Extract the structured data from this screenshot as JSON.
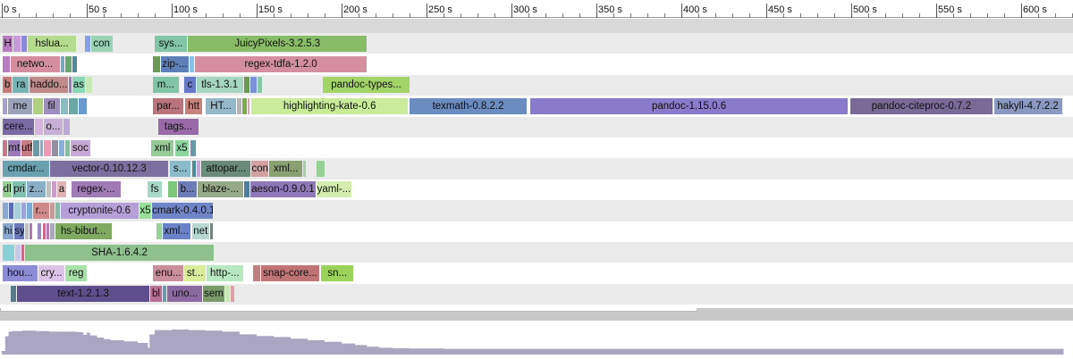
{
  "ruler": {
    "ticks": [
      "0 s",
      "50 s",
      "100 s",
      "150 s",
      "200 s",
      "250 s",
      "300 s",
      "350 s",
      "400 s",
      "450 s",
      "500 s",
      "550 s",
      "600 s"
    ]
  },
  "lanes": [
    [
      {
        "label": "H",
        "start": 0.5,
        "end": 6.5,
        "color": "#b87cc0"
      },
      {
        "label": "",
        "start": 7,
        "end": 11,
        "color": "#c59ad8"
      },
      {
        "label": "",
        "start": 11.5,
        "end": 15,
        "color": "#8a8ad6"
      },
      {
        "label": "hslua...",
        "start": 15.5,
        "end": 43.5,
        "color": "#b4dc8c"
      },
      {
        "label": "",
        "start": 49,
        "end": 52,
        "color": "#86a0e4"
      },
      {
        "label": "con",
        "start": 52.5,
        "end": 65,
        "color": "#9ad2b4"
      },
      {
        "label": "sys...",
        "start": 90,
        "end": 109,
        "color": "#80c5a6"
      },
      {
        "label": "JuicyPixels-3.2.5.3",
        "start": 109.5,
        "end": 215,
        "color": "#88bc66"
      }
    ],
    [
      {
        "label": "",
        "start": 0.5,
        "end": 4.5,
        "color": "#b87cc0"
      },
      {
        "label": "netwo...",
        "start": 5,
        "end": 34,
        "color": "#d48e9e"
      },
      {
        "label": "",
        "start": 34.5,
        "end": 37,
        "color": "#7aa8b8"
      },
      {
        "label": "",
        "start": 37.5,
        "end": 41,
        "color": "#68a870"
      },
      {
        "label": "",
        "start": 41.5,
        "end": 44,
        "color": "#4e8a9a"
      },
      {
        "label": "",
        "start": 89,
        "end": 93,
        "color": "#6a9a56"
      },
      {
        "label": "zip-...",
        "start": 93.5,
        "end": 110,
        "color": "#5d80b8"
      },
      {
        "label": "",
        "start": 110.5,
        "end": 113,
        "color": "#8ac0e8"
      },
      {
        "label": "regex-tdfa-1.2.0",
        "start": 113.5,
        "end": 215,
        "color": "#d48e9e"
      }
    ],
    [
      {
        "label": "b",
        "start": 0.5,
        "end": 6,
        "color": "#c77a7a"
      },
      {
        "label": "ra",
        "start": 6.5,
        "end": 16,
        "color": "#78b4b4"
      },
      {
        "label": "haddo...",
        "start": 16.5,
        "end": 39,
        "color": "#c08a8a"
      },
      {
        "label": "",
        "start": 39.5,
        "end": 41,
        "color": "#9a7ab8"
      },
      {
        "label": "as",
        "start": 41.5,
        "end": 49,
        "color": "#8ad6b6"
      },
      {
        "label": "",
        "start": 49.5,
        "end": 53,
        "color": "#c8e8b8"
      },
      {
        "label": "m...",
        "start": 89,
        "end": 104,
        "color": "#80c5a6"
      },
      {
        "label": "",
        "start": 104.5,
        "end": 107,
        "color": "#f4f4f4"
      },
      {
        "label": "c",
        "start": 107.5,
        "end": 114,
        "color": "#6678c8"
      },
      {
        "label": "tls-1.3.1",
        "start": 114.5,
        "end": 142,
        "color": "#a6d6c2"
      },
      {
        "label": "",
        "start": 142.5,
        "end": 146,
        "color": "#6a9a56"
      },
      {
        "label": "",
        "start": 146.5,
        "end": 150,
        "color": "#7a90d8"
      },
      {
        "label": "",
        "start": 150.5,
        "end": 153,
        "color": "#88c8a8"
      },
      {
        "label": "pandoc-types...",
        "start": 189,
        "end": 240,
        "color": "#a2d468"
      }
    ],
    [
      {
        "label": "",
        "start": 0.5,
        "end": 3,
        "color": "#a8a0cc"
      },
      {
        "label": "me",
        "start": 3.5,
        "end": 18,
        "color": "#9aa2bc"
      },
      {
        "label": "",
        "start": 18.5,
        "end": 24,
        "color": "#b0d080"
      },
      {
        "label": "fil",
        "start": 24.5,
        "end": 34,
        "color": "#9e8ec0"
      },
      {
        "label": "",
        "start": 34.5,
        "end": 39,
        "color": "#8abcc0"
      },
      {
        "label": "",
        "start": 39.5,
        "end": 45,
        "color": "#6aa8a8"
      },
      {
        "label": "",
        "start": 45.5,
        "end": 50,
        "color": "#6a9ad0"
      },
      {
        "label": "par...",
        "start": 89,
        "end": 107,
        "color": "#b9747c"
      },
      {
        "label": "htt",
        "start": 108,
        "end": 118,
        "color": "#c4847c"
      },
      {
        "label": "HT...",
        "start": 120,
        "end": 138,
        "color": "#95b8c8"
      },
      {
        "label": "",
        "start": 138.5,
        "end": 141,
        "color": "#b4b4b4"
      },
      {
        "label": "",
        "start": 141.5,
        "end": 144,
        "color": "#7aaa4a"
      },
      {
        "label": "",
        "start": 144.5,
        "end": 146,
        "color": "#e0a0a8"
      },
      {
        "label": "highlighting-kate-0.6",
        "start": 147,
        "end": 239,
        "color": "#c8ec9a"
      },
      {
        "label": "texmath-0.8.2.2",
        "start": 240,
        "end": 309,
        "color": "#6b8cbf"
      },
      {
        "label": "pandoc-1.15.0.6",
        "start": 311,
        "end": 498,
        "color": "#8a7acc"
      },
      {
        "label": "pandoc-citeproc-0.7.2",
        "start": 499.5,
        "end": 583,
        "color": "#7a6a98"
      },
      {
        "label": "hakyll-4.7.2.2",
        "start": 584,
        "end": 624,
        "color": "#8a98c2"
      }
    ],
    [
      {
        "label": "cere...",
        "start": 0.5,
        "end": 19,
        "color": "#7a6aa4"
      },
      {
        "label": "",
        "start": 19.5,
        "end": 24,
        "color": "#d6b4e0"
      },
      {
        "label": "o...",
        "start": 24.5,
        "end": 36,
        "color": "#c6b0d8"
      },
      {
        "label": "",
        "start": 36.5,
        "end": 40,
        "color": "#bca8d8"
      },
      {
        "label": "tags...",
        "start": 92,
        "end": 116,
        "color": "#9a6aa8"
      }
    ],
    [
      {
        "label": "",
        "start": 0.5,
        "end": 3,
        "color": "#c47a8a"
      },
      {
        "label": "mt",
        "start": 3.5,
        "end": 11,
        "color": "#9a7ab8"
      },
      {
        "label": "utf",
        "start": 11.5,
        "end": 18,
        "color": "#c67a84"
      },
      {
        "label": "",
        "start": 18.5,
        "end": 22,
        "color": "#6a9aa8"
      },
      {
        "label": "",
        "start": 22.5,
        "end": 24,
        "color": "#8aa8d0"
      },
      {
        "label": "",
        "start": 24.5,
        "end": 29,
        "color": "#ee9ab4"
      },
      {
        "label": "",
        "start": 29.5,
        "end": 33,
        "color": "#9090a0"
      },
      {
        "label": "",
        "start": 33.5,
        "end": 37,
        "color": "#8ab0d8"
      },
      {
        "label": "",
        "start": 37.5,
        "end": 40,
        "color": "#80c0a0"
      },
      {
        "label": "soc",
        "start": 40.5,
        "end": 52,
        "color": "#c6aad4"
      },
      {
        "label": "xml",
        "start": 88,
        "end": 101,
        "color": "#96ca96"
      },
      {
        "label": "x5",
        "start": 102,
        "end": 110,
        "color": "#8ad69e"
      },
      {
        "label": "",
        "start": 111,
        "end": 114,
        "color": "#6a9aa8"
      }
    ],
    [
      {
        "label": "cmdar...",
        "start": 0.5,
        "end": 28,
        "color": "#6aa0b0"
      },
      {
        "label": "vector-0.10.12.3",
        "start": 28.5,
        "end": 98,
        "color": "#7c6e9e"
      },
      {
        "label": "s...",
        "start": 99,
        "end": 111,
        "color": "#8cbccc"
      },
      {
        "label": "",
        "start": 112,
        "end": 114,
        "color": "#4e8a9a"
      },
      {
        "label": "",
        "start": 114.5,
        "end": 117,
        "color": "#c8a8d8"
      },
      {
        "label": "attopar...",
        "start": 117.5,
        "end": 146.5,
        "color": "#6a8a7a"
      },
      {
        "label": "con",
        "start": 147,
        "end": 157,
        "color": "#d2a0a0"
      },
      {
        "label": "xml...",
        "start": 157.5,
        "end": 177,
        "color": "#8aa070"
      },
      {
        "label": "",
        "start": 177.5,
        "end": 179,
        "color": "#a8d0a8"
      },
      {
        "label": "",
        "start": 185,
        "end": 190,
        "color": "#98d098"
      }
    ],
    [
      {
        "label": "dl",
        "start": 0.5,
        "end": 6,
        "color": "#98d098"
      },
      {
        "label": "pri",
        "start": 6.5,
        "end": 14,
        "color": "#80c0b0"
      },
      {
        "label": "z...",
        "start": 14.5,
        "end": 26,
        "color": "#8aaec8"
      },
      {
        "label": "",
        "start": 26.5,
        "end": 29,
        "color": "#c0c0c0"
      },
      {
        "label": "",
        "start": 29.5,
        "end": 32,
        "color": "#c8a0c8"
      },
      {
        "label": "a",
        "start": 32.5,
        "end": 38,
        "color": "#e0b4b4"
      },
      {
        "label": "regex-...",
        "start": 41,
        "end": 70,
        "color": "#a07ab4"
      },
      {
        "label": "fs",
        "start": 86,
        "end": 94,
        "color": "#a8d8c8"
      },
      {
        "label": "",
        "start": 98,
        "end": 103,
        "color": "#7ec87e"
      },
      {
        "label": "b...",
        "start": 103.5,
        "end": 115,
        "color": "#6c7cb6"
      },
      {
        "label": "blaze-...",
        "start": 115.5,
        "end": 142,
        "color": "#96aa88"
      },
      {
        "label": "",
        "start": 142.5,
        "end": 146,
        "color": "#507ca0"
      },
      {
        "label": "aeson-0.9.0.1",
        "start": 146.5,
        "end": 184.5,
        "color": "#8e78b8"
      },
      {
        "label": "yaml-...",
        "start": 185,
        "end": 206,
        "color": "#d4ecb0"
      }
    ],
    [
      {
        "label": "",
        "start": 0.5,
        "end": 3.5,
        "color": "#8aa8d0"
      },
      {
        "label": "",
        "start": 4,
        "end": 7,
        "color": "#5c6cae"
      },
      {
        "label": "",
        "start": 7.5,
        "end": 11,
        "color": "#a8d0d8"
      },
      {
        "label": "",
        "start": 11.5,
        "end": 14,
        "color": "#9aa4d6"
      },
      {
        "label": "",
        "start": 14.5,
        "end": 18,
        "color": "#7aacd8"
      },
      {
        "label": "r...",
        "start": 18.5,
        "end": 28,
        "color": "#d08a8a"
      },
      {
        "label": "",
        "start": 28.5,
        "end": 31,
        "color": "#c49a9a"
      },
      {
        "label": "",
        "start": 31.5,
        "end": 34,
        "color": "#8ab8a8"
      },
      {
        "label": "cryptonite-0.6",
        "start": 34.5,
        "end": 80.5,
        "color": "#b6a0d8"
      },
      {
        "label": "x5",
        "start": 81,
        "end": 88,
        "color": "#9ae09a"
      },
      {
        "label": "cmark-0.4.0.1",
        "start": 88.5,
        "end": 124,
        "color": "#7084c8"
      }
    ],
    [
      {
        "label": "hi",
        "start": 0.5,
        "end": 7,
        "color": "#8aa8d0"
      },
      {
        "label": "sy",
        "start": 7.5,
        "end": 13,
        "color": "#6a78b8"
      },
      {
        "label": "",
        "start": 13.5,
        "end": 16,
        "color": "#c0c0c0"
      },
      {
        "label": "",
        "start": 16.5,
        "end": 18,
        "color": "#b07ab0"
      },
      {
        "label": "",
        "start": 21,
        "end": 23,
        "color": "#9a8ac0"
      },
      {
        "label": "",
        "start": 24,
        "end": 26,
        "color": "#c86a8a"
      },
      {
        "label": "",
        "start": 26.5,
        "end": 28,
        "color": "#b07ab0"
      },
      {
        "label": "",
        "start": 28.5,
        "end": 31,
        "color": "#a8a8b8"
      },
      {
        "label": "hs-bibut...",
        "start": 31.5,
        "end": 64.5,
        "color": "#7eaa62"
      },
      {
        "label": "",
        "start": 91,
        "end": 94,
        "color": "#98d098"
      },
      {
        "label": "xml...",
        "start": 94.5,
        "end": 111,
        "color": "#6a82c8"
      },
      {
        "label": "net",
        "start": 112,
        "end": 122,
        "color": "#b4d8d0"
      },
      {
        "label": "",
        "start": 122.5,
        "end": 124,
        "color": "#6a8a7a"
      }
    ],
    [
      {
        "label": "",
        "start": 0.5,
        "end": 7.5,
        "color": "#8ad0d8"
      },
      {
        "label": "",
        "start": 8,
        "end": 11,
        "color": "#c8c8e8"
      },
      {
        "label": "",
        "start": 11.5,
        "end": 13,
        "color": "#c86a8a"
      },
      {
        "label": "SHA-1.6.4.2",
        "start": 13.5,
        "end": 125,
        "color": "#8ec08e"
      }
    ],
    [
      {
        "label": "hou...",
        "start": 0.5,
        "end": 21,
        "color": "#8c8cd8"
      },
      {
        "label": "cry...",
        "start": 21.5,
        "end": 37,
        "color": "#dcc4e8"
      },
      {
        "label": "reg",
        "start": 37.5,
        "end": 50,
        "color": "#a8e0a8"
      },
      {
        "label": "enu...",
        "start": 89,
        "end": 107,
        "color": "#c9909c"
      },
      {
        "label": "st...",
        "start": 107.5,
        "end": 120,
        "color": "#d8ec9a"
      },
      {
        "label": "http-...",
        "start": 120.5,
        "end": 142,
        "color": "#b8e8c0"
      },
      {
        "label": "",
        "start": 148,
        "end": 152,
        "color": "#c08080"
      },
      {
        "label": "snap-core...",
        "start": 152.5,
        "end": 187,
        "color": "#c07474"
      },
      {
        "label": "sn...",
        "start": 188,
        "end": 207,
        "color": "#9ad25a"
      }
    ],
    [
      {
        "label": "",
        "start": 5.5,
        "end": 8.5,
        "color": "#5a7a8a"
      },
      {
        "label": "text-1.2.1.3",
        "start": 9,
        "end": 87,
        "color": "#5e4f8c"
      },
      {
        "label": "bl",
        "start": 87.5,
        "end": 94,
        "color": "#b47090"
      },
      {
        "label": "",
        "start": 94.5,
        "end": 97,
        "color": "#6a9aa8"
      },
      {
        "label": "uno...",
        "start": 97.5,
        "end": 118,
        "color": "#8a6aa0"
      },
      {
        "label": "sem",
        "start": 118.5,
        "end": 131,
        "color": "#7a9a6a"
      },
      {
        "label": "",
        "start": 131.5,
        "end": 134,
        "color": "#c8e8b8"
      },
      {
        "label": "",
        "start": 134.5,
        "end": 137,
        "color": "#e0a0a8"
      }
    ]
  ],
  "histogram": {
    "color": "#aaa6c2",
    "series": [
      [
        0,
        0
      ],
      [
        2,
        0.55
      ],
      [
        4,
        0.72
      ],
      [
        6,
        0.74
      ],
      [
        12,
        0.76
      ],
      [
        20,
        0.74
      ],
      [
        28,
        0.72
      ],
      [
        40,
        0.72
      ],
      [
        44,
        0.7
      ],
      [
        48,
        0.6
      ],
      [
        50,
        0.68
      ],
      [
        52,
        0.58
      ],
      [
        56,
        0.5
      ],
      [
        60,
        0.44
      ],
      [
        64,
        0.4
      ],
      [
        72,
        0.36
      ],
      [
        80,
        0.3
      ],
      [
        86,
        0.12
      ],
      [
        87,
        0.62
      ],
      [
        90,
        0.78
      ],
      [
        100,
        0.8
      ],
      [
        110,
        0.78
      ],
      [
        120,
        0.76
      ],
      [
        130,
        0.72
      ],
      [
        140,
        0.62
      ],
      [
        150,
        0.56
      ],
      [
        160,
        0.52
      ],
      [
        170,
        0.46
      ],
      [
        180,
        0.4
      ],
      [
        190,
        0.34
      ],
      [
        200,
        0.28
      ],
      [
        208,
        0.22
      ],
      [
        215,
        0.16
      ],
      [
        222,
        0.12
      ],
      [
        230,
        0.1
      ],
      [
        240,
        0.09
      ],
      [
        260,
        0.08
      ],
      [
        300,
        0.08
      ],
      [
        498,
        0.08
      ],
      [
        499,
        0.08
      ],
      [
        624,
        0.08
      ],
      [
        625,
        0
      ]
    ],
    "viewport": [
      0.0,
      0.65
    ]
  }
}
